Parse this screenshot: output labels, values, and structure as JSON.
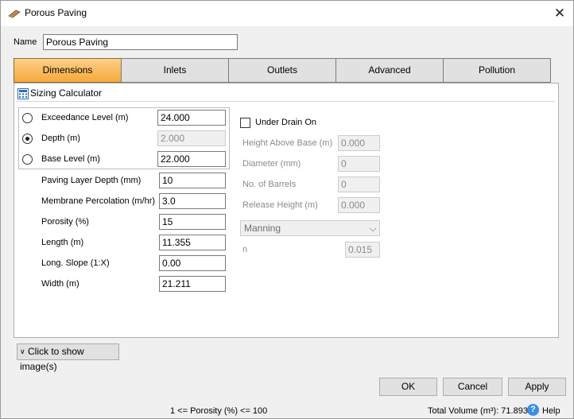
{
  "window": {
    "title": "Porous Paving",
    "close_symbol": "✕"
  },
  "name_field": {
    "label": "Name",
    "value": "Porous Paving"
  },
  "tabs": [
    {
      "label": "Dimensions",
      "active": true
    },
    {
      "label": "Inlets",
      "active": false
    },
    {
      "label": "Outlets",
      "active": false
    },
    {
      "label": "Advanced",
      "active": false
    },
    {
      "label": "Pollution",
      "active": false
    }
  ],
  "sizing_calculator": {
    "label": "Sizing Calculator"
  },
  "levels": [
    {
      "label": "Exceedance Level (m)",
      "value": "24.000",
      "selected": false,
      "enabled": true
    },
    {
      "label": "Depth (m)",
      "value": "2.000",
      "selected": true,
      "enabled": false
    },
    {
      "label": "Base Level (m)",
      "value": "22.000",
      "selected": false,
      "enabled": true
    }
  ],
  "fields": [
    {
      "label": "Paving Layer Depth (mm)",
      "value": "10"
    },
    {
      "label": "Membrane Percolation (m/hr)",
      "value": "3.0"
    },
    {
      "label": "Porosity (%)",
      "value": "15"
    },
    {
      "label": "Length (m)",
      "value": "11.355"
    },
    {
      "label": "Long. Slope (1:X)",
      "value": "0.00"
    },
    {
      "label": "Width (m)",
      "value": "21.211"
    }
  ],
  "underdrain": {
    "checkbox_label": "Under Drain On",
    "checked": false,
    "fields": [
      {
        "label": "Height Above Base (m)",
        "value": "0.000"
      },
      {
        "label": "Diameter (mm)",
        "value": "0"
      },
      {
        "label": "No. of Barrels",
        "value": "0"
      },
      {
        "label": "Release Height (m)",
        "value": "0.000"
      }
    ],
    "method_select": "Manning",
    "n_label": "n",
    "n_value": "0.015"
  },
  "show_images_button": "Click to show image(s)",
  "buttons": {
    "ok": "OK",
    "cancel": "Cancel",
    "apply": "Apply"
  },
  "status": {
    "hint": "1 <= Porosity (%) <= 100",
    "total_volume": "Total Volume (m³): 71.893",
    "help": "Help"
  }
}
